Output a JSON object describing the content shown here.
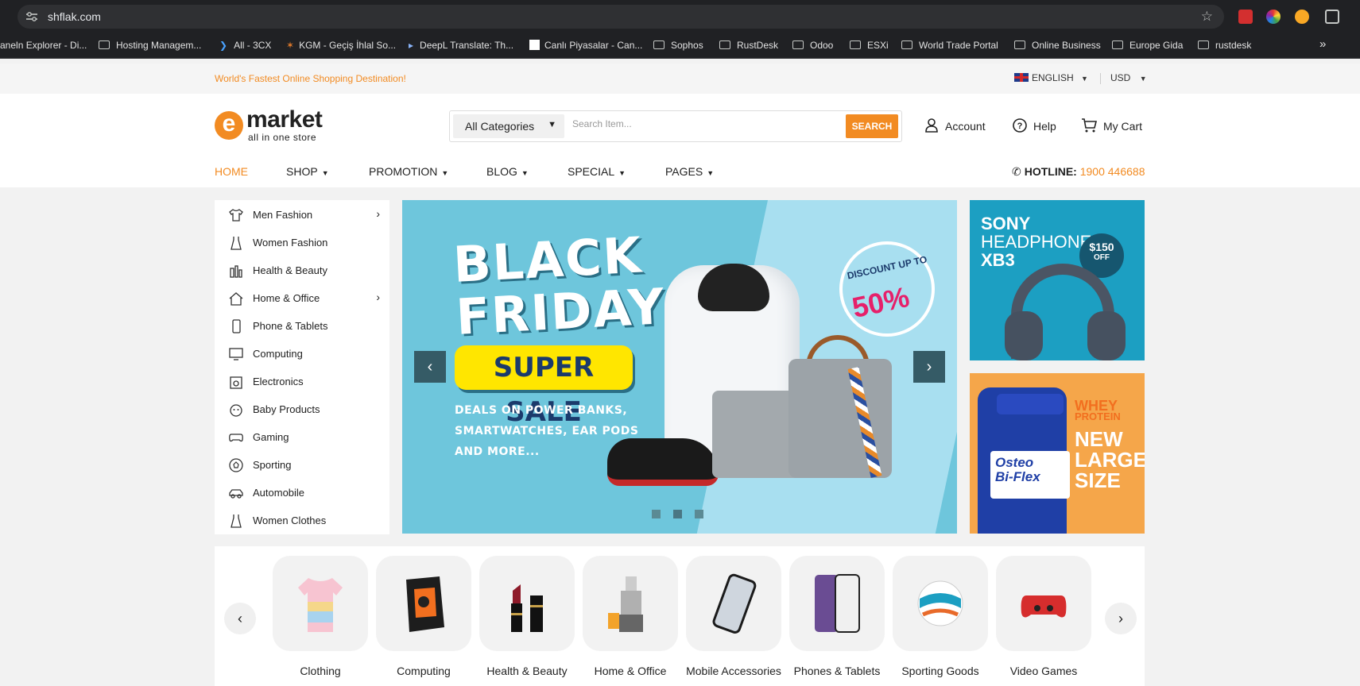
{
  "browser": {
    "url": "shflak.com",
    "bookmarks": [
      "aneln Explorer - Di...",
      "Hosting Managem...",
      "All - 3CX",
      "KGM - Geçiş İhlal So...",
      "DeepL Translate: Th...",
      "Canlı Piyasalar - Can...",
      "Sophos",
      "RustDesk",
      "Odoo",
      "ESXi",
      "World Trade Portal",
      "Online Business",
      "Europe Gida",
      "rustdesk"
    ],
    "more": "»"
  },
  "topbar": {
    "tagline": "World's Fastest Online Shopping Destination!",
    "language": "ENGLISH",
    "currency": "USD"
  },
  "header": {
    "logo_word": "market",
    "logo_letter": "e",
    "logo_sub": "all in one store",
    "category_select": "All Categories",
    "search_placeholder": "Search Item...",
    "search_button": "SEARCH",
    "account": "Account",
    "help": "Help",
    "cart": "My Cart"
  },
  "nav": {
    "items": [
      "HOME",
      "SHOP",
      "PROMOTION",
      "BLOG",
      "SPECIAL",
      "PAGES"
    ],
    "hotline_label": "HOTLINE:",
    "hotline_number": "1900 446688",
    "active_color": "#f28b22"
  },
  "sidebar": {
    "items": [
      {
        "label": "Men Fashion",
        "icon": "tshirt-icon",
        "has_sub": true
      },
      {
        "label": "Women Fashion",
        "icon": "dress-icon",
        "has_sub": false
      },
      {
        "label": "Health & Beauty",
        "icon": "beauty-icon",
        "has_sub": false
      },
      {
        "label": "Home & Office",
        "icon": "home-icon",
        "has_sub": true
      },
      {
        "label": "Phone & Tablets",
        "icon": "phone-icon",
        "has_sub": false
      },
      {
        "label": "Computing",
        "icon": "monitor-icon",
        "has_sub": false
      },
      {
        "label": "Electronics",
        "icon": "electronics-icon",
        "has_sub": false
      },
      {
        "label": "Baby Products",
        "icon": "baby-icon",
        "has_sub": false
      },
      {
        "label": "Gaming",
        "icon": "gamepad-icon",
        "has_sub": false
      },
      {
        "label": "Sporting",
        "icon": "ball-icon",
        "has_sub": false
      },
      {
        "label": "Automobile",
        "icon": "car-icon",
        "has_sub": false
      },
      {
        "label": "Women Clothes",
        "icon": "dress-icon",
        "has_sub": false
      }
    ]
  },
  "hero": {
    "title_line1": "BLACK",
    "title_line2": "FRIDAY",
    "badge": "SUPER SALE",
    "deals_line1": "DEALS ON POWER BANKS,",
    "deals_line2": "SMARTWATCHES, EAR PODS",
    "deals_line3": "AND MORE...",
    "discount_label": "DISCOUNT UP TO",
    "discount_value": "50%",
    "prev": "‹",
    "next": "›"
  },
  "side_banners": {
    "sony_title_1": "SONY",
    "sony_title_2": "HEADPHONE",
    "sony_title_3": "XB3",
    "sony_price": "$150",
    "sony_off": "OFF",
    "whey_1": "WHEY",
    "whey_2": "PROTEIN",
    "new_1": "NEW",
    "new_2": "LARGER",
    "new_3": "SIZE",
    "bottle_brand_1": "Osteo",
    "bottle_brand_2": "Bi-Flex"
  },
  "categories": {
    "prev": "‹",
    "next": "›",
    "items": [
      "Clothing",
      "Computing",
      "Health & Beauty",
      "Home & Office",
      "Mobile Accessories",
      "Phones & Tablets",
      "Sporting Goods",
      "Video Games"
    ]
  }
}
